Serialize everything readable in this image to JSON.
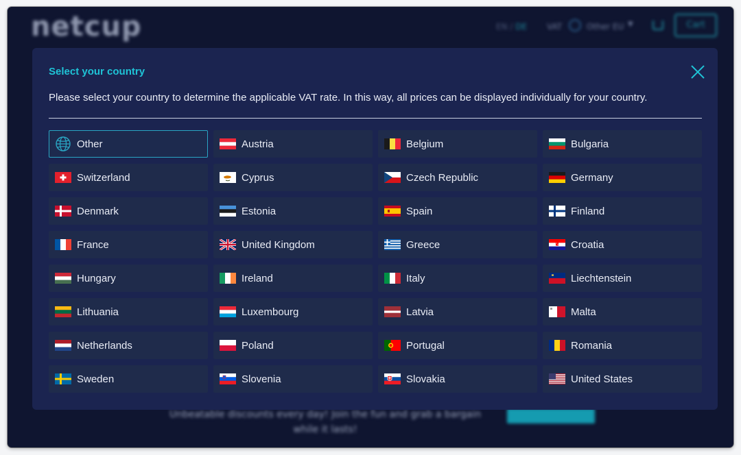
{
  "header": {
    "logo": "netcup",
    "language_current": "EN",
    "language_separator": "/",
    "language_alt": "DE",
    "vat_label": "VAT",
    "vat_country": "Other EU",
    "cart_label": "Cart"
  },
  "promo": {
    "text": "Unbeatable discounts every day! Join the fun and grab a bargain while it lasts!"
  },
  "modal": {
    "title": "Select your country",
    "description": "Please select your country to determine the applicable VAT rate. In this way, all prices can be displayed individually for your country.",
    "selected": "Other",
    "countries": [
      {
        "label": "Other",
        "icon": "globe-icon"
      },
      {
        "label": "Austria",
        "icon": "flag-austria-icon"
      },
      {
        "label": "Belgium",
        "icon": "flag-belgium-icon"
      },
      {
        "label": "Bulgaria",
        "icon": "flag-bulgaria-icon"
      },
      {
        "label": "Switzerland",
        "icon": "flag-switzerland-icon"
      },
      {
        "label": "Cyprus",
        "icon": "flag-cyprus-icon"
      },
      {
        "label": "Czech Republic",
        "icon": "flag-czech-republic-icon"
      },
      {
        "label": "Germany",
        "icon": "flag-germany-icon"
      },
      {
        "label": "Denmark",
        "icon": "flag-denmark-icon"
      },
      {
        "label": "Estonia",
        "icon": "flag-estonia-icon"
      },
      {
        "label": "Spain",
        "icon": "flag-spain-icon"
      },
      {
        "label": "Finland",
        "icon": "flag-finland-icon"
      },
      {
        "label": "France",
        "icon": "flag-france-icon"
      },
      {
        "label": "United Kingdom",
        "icon": "flag-united-kingdom-icon"
      },
      {
        "label": "Greece",
        "icon": "flag-greece-icon"
      },
      {
        "label": "Croatia",
        "icon": "flag-croatia-icon"
      },
      {
        "label": "Hungary",
        "icon": "flag-hungary-icon"
      },
      {
        "label": "Ireland",
        "icon": "flag-ireland-icon"
      },
      {
        "label": "Italy",
        "icon": "flag-italy-icon"
      },
      {
        "label": "Liechtenstein",
        "icon": "flag-liechtenstein-icon"
      },
      {
        "label": "Lithuania",
        "icon": "flag-lithuania-icon"
      },
      {
        "label": "Luxembourg",
        "icon": "flag-luxembourg-icon"
      },
      {
        "label": "Latvia",
        "icon": "flag-latvia-icon"
      },
      {
        "label": "Malta",
        "icon": "flag-malta-icon"
      },
      {
        "label": "Netherlands",
        "icon": "flag-netherlands-icon"
      },
      {
        "label": "Poland",
        "icon": "flag-poland-icon"
      },
      {
        "label": "Portugal",
        "icon": "flag-portugal-icon"
      },
      {
        "label": "Romania",
        "icon": "flag-romania-icon"
      },
      {
        "label": "Sweden",
        "icon": "flag-sweden-icon"
      },
      {
        "label": "Slovenia",
        "icon": "flag-slovenia-icon"
      },
      {
        "label": "Slovakia",
        "icon": "flag-slovakia-icon"
      },
      {
        "label": "United States",
        "icon": "flag-united-states-icon"
      }
    ]
  },
  "colors": {
    "accent": "#1fc3d6",
    "page_background": "#0f1530",
    "modal_background": "#1b2450",
    "option_background": "#1f2b4b",
    "selected_border": "#2aa6c4"
  }
}
